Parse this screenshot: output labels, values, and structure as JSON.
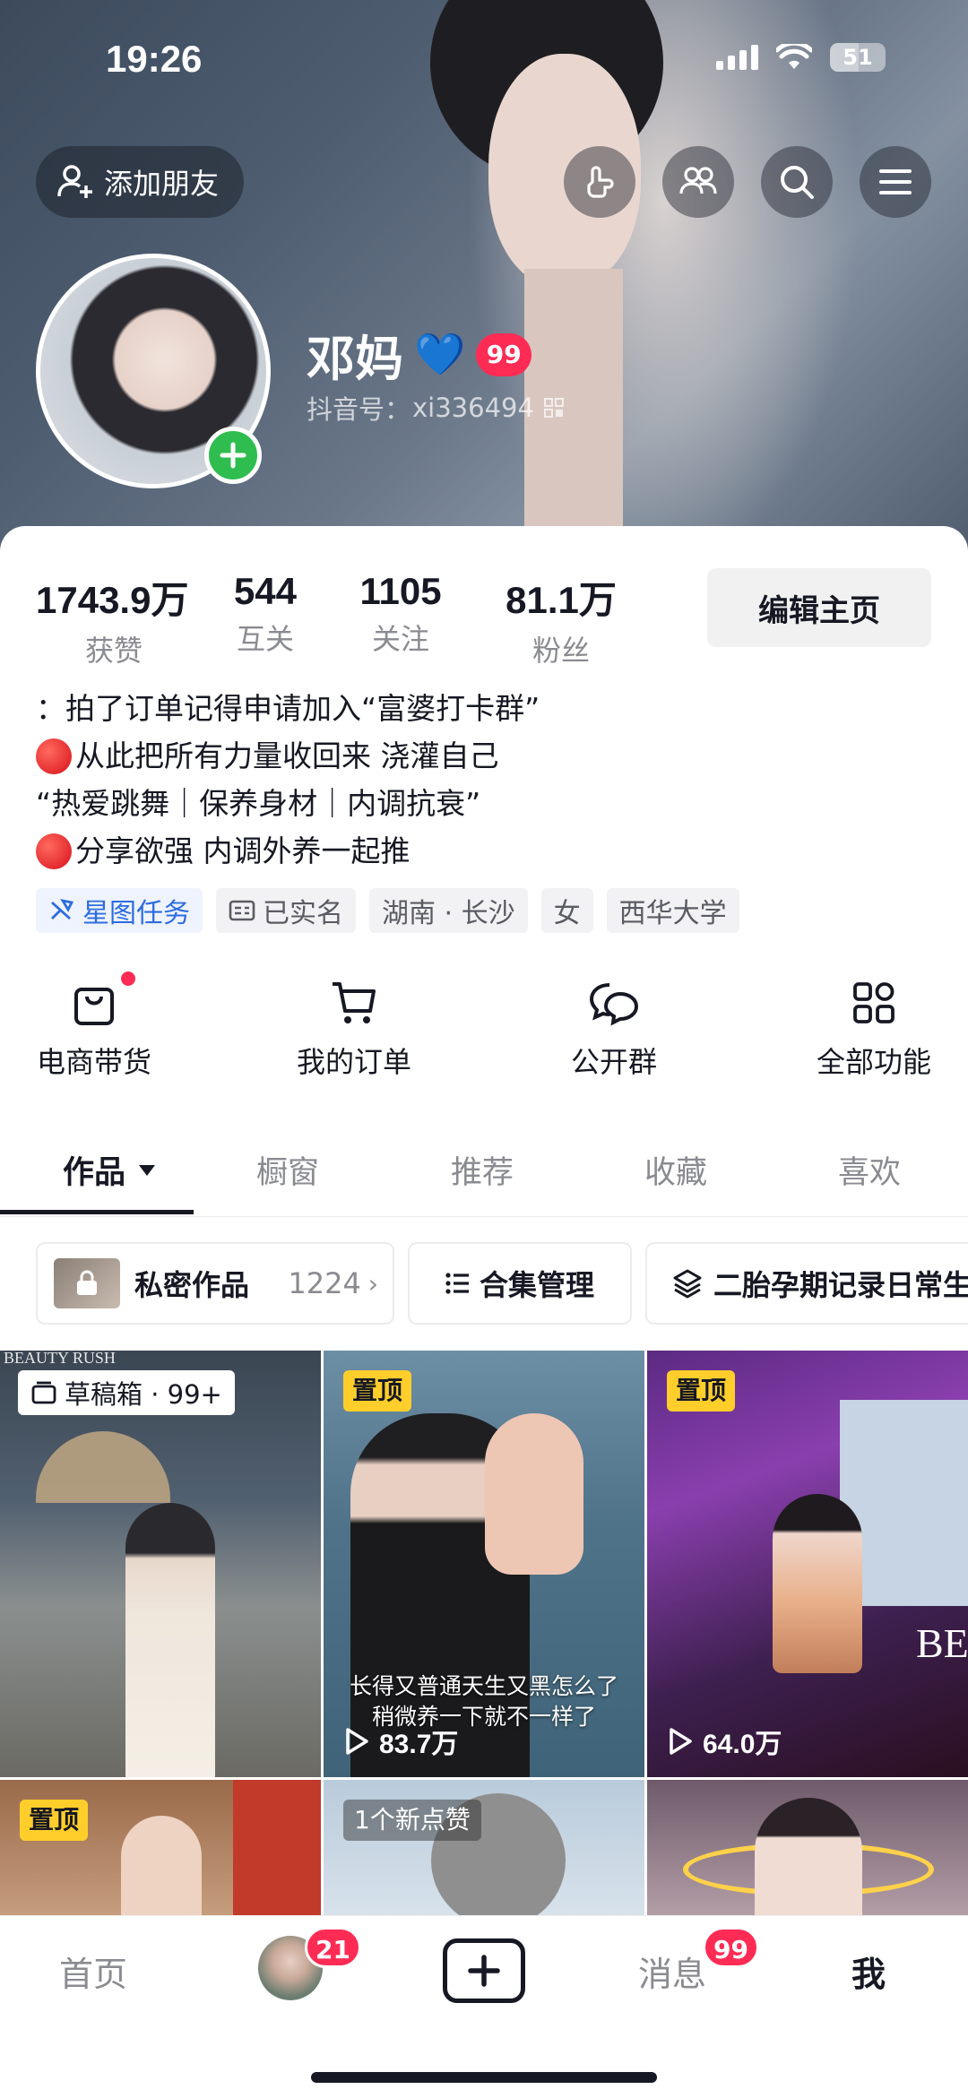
{
  "status_bar": {
    "time": "19:26",
    "battery": "51",
    "battery_level": 0.51
  },
  "header": {
    "add_friend_label": "添加朋友",
    "icons": [
      "hand-icon",
      "friends-icon",
      "search-icon",
      "menu-icon"
    ]
  },
  "profile": {
    "name": "邓妈",
    "name_emoji": "💙",
    "badge": "99",
    "douyin_id_label": "抖音号：",
    "douyin_id": "xi336494"
  },
  "stats": [
    {
      "value": "1743.9万",
      "label": "获赞"
    },
    {
      "value": "544",
      "label": "互关"
    },
    {
      "value": "1105",
      "label": "关注"
    },
    {
      "value": "81.1万",
      "label": "粉丝"
    }
  ],
  "edit_button": "编辑主页",
  "bio": {
    "line1": "：拍了订单记得申请加入“富婆打卡群”",
    "line2": "从此把所有力量收回来 浇灌自己",
    "line3": "“热爱跳舞｜保养身材｜内调抗衰”",
    "line4": "分享欲强 内调外养一起推"
  },
  "tags": {
    "star_task": "星图任务",
    "verified": "已实名",
    "location": "湖南 · 长沙",
    "gender": "女",
    "school": "西华大学"
  },
  "functions": {
    "shop": "电商带货",
    "orders": "我的订单",
    "group": "公开群",
    "all": "全部功能"
  },
  "tabs": {
    "works": "作品",
    "window": "橱窗",
    "recommend": "推荐",
    "favorites": "收藏",
    "likes": "喜欢"
  },
  "chips": {
    "private_label": "私密作品",
    "private_count": "1224",
    "collection_mgmt": "合集管理",
    "collection_name": "二胎孕期记录日常生"
  },
  "grid": {
    "drafts": "草稿箱 · 99+",
    "pinned": "置顶",
    "caption_line1": "长得又普通天生又黑怎么了",
    "caption_line2": "稍微养一下就不一样了",
    "plays_2": "83.7万",
    "plays_3": "64.0万",
    "new_like": "1个新点赞",
    "watermark": "BEAUTY RUSH"
  },
  "bottom_nav": {
    "home": "首页",
    "friends_badge": "21",
    "messages": "消息",
    "messages_badge": "99",
    "me": "我"
  },
  "colors": {
    "accent": "#fe2c55",
    "pin": "#ffce2b",
    "plus_green": "#2fbd4f",
    "link_blue": "#2d6cdf"
  }
}
